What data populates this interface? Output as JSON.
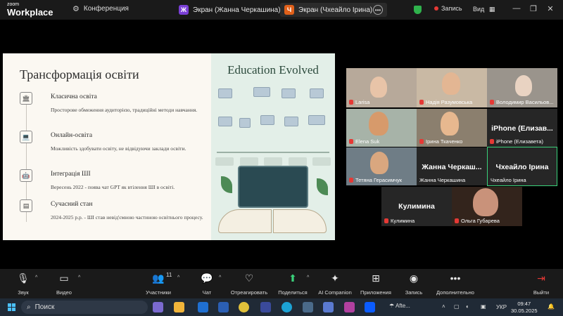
{
  "app": {
    "logo_small": "zoom",
    "logo_main": "Workplace",
    "meeting_title": "Конференция",
    "share_tabs": [
      {
        "badge": "Ж",
        "label": "Экран (Жанна Черкашина)"
      },
      {
        "badge": "Ч",
        "label": "Экран (Чхеайло Ірина)"
      }
    ],
    "record_label": "Запись",
    "view_label": "Вид"
  },
  "slide": {
    "title": "Трансформація освіти",
    "right_title": "Education Evolved",
    "items": [
      {
        "heading": "Класична освіта",
        "text": "Просторове обмеження аудиторією, традиційні методи навчання."
      },
      {
        "heading": "Онлайн-освіта",
        "text": "Можливість здобувати освіту, не відвідуючи заклади освіти."
      },
      {
        "heading": "Інтеграція ШІ",
        "text": "Вересень 2022 - поява чат GPT як втілення ШІ в освіті."
      },
      {
        "heading": "Сучасний стан",
        "text": "2024-2025 р.р. - ШІ став невід'ємною частиною освітнього процесу."
      }
    ]
  },
  "participants": [
    {
      "name": "Larisa",
      "video": true
    },
    {
      "name": "Надія Разумовська",
      "video": true
    },
    {
      "name": "Володимир Васильов...",
      "video": true
    },
    {
      "name": "Elena Suk",
      "video": true
    },
    {
      "name": "Ірина Ткаченко",
      "video": true
    },
    {
      "name": "iPhone (Елизавета)",
      "big": "iPhone  (Елизав...",
      "video": false
    },
    {
      "name": "Тетяна Герасимчук",
      "video": true
    },
    {
      "name": "Жанна Черкашина",
      "big": "Жанна  Черкаш...",
      "video": false
    },
    {
      "name": "Чхеайло Ірина",
      "big": "Чхеайло Ірина",
      "video": false,
      "active": true
    },
    {
      "name": "Кулимина",
      "big": "Кулимина",
      "video": false
    },
    {
      "name": "Ольга Губарева",
      "video": true
    }
  ],
  "toolbar": {
    "audio": "Звук",
    "video": "Видео",
    "participants": "Участники",
    "participants_count": "11",
    "chat": "Чат",
    "react": "Отреагировать",
    "share": "Поделиться",
    "ai": "AI Companion",
    "apps": "Приложения",
    "record": "Запись",
    "more": "Дополнительно",
    "leave": "Выйти"
  },
  "taskbar": {
    "search": "Поиск",
    "weather": "Afte...",
    "lang": "УКР",
    "time": "09:47",
    "date": "30.05.2025"
  },
  "colors": {
    "accent_green": "#3ad17a",
    "muted_red": "#e53935",
    "brand_blue": "#0b5cff"
  }
}
